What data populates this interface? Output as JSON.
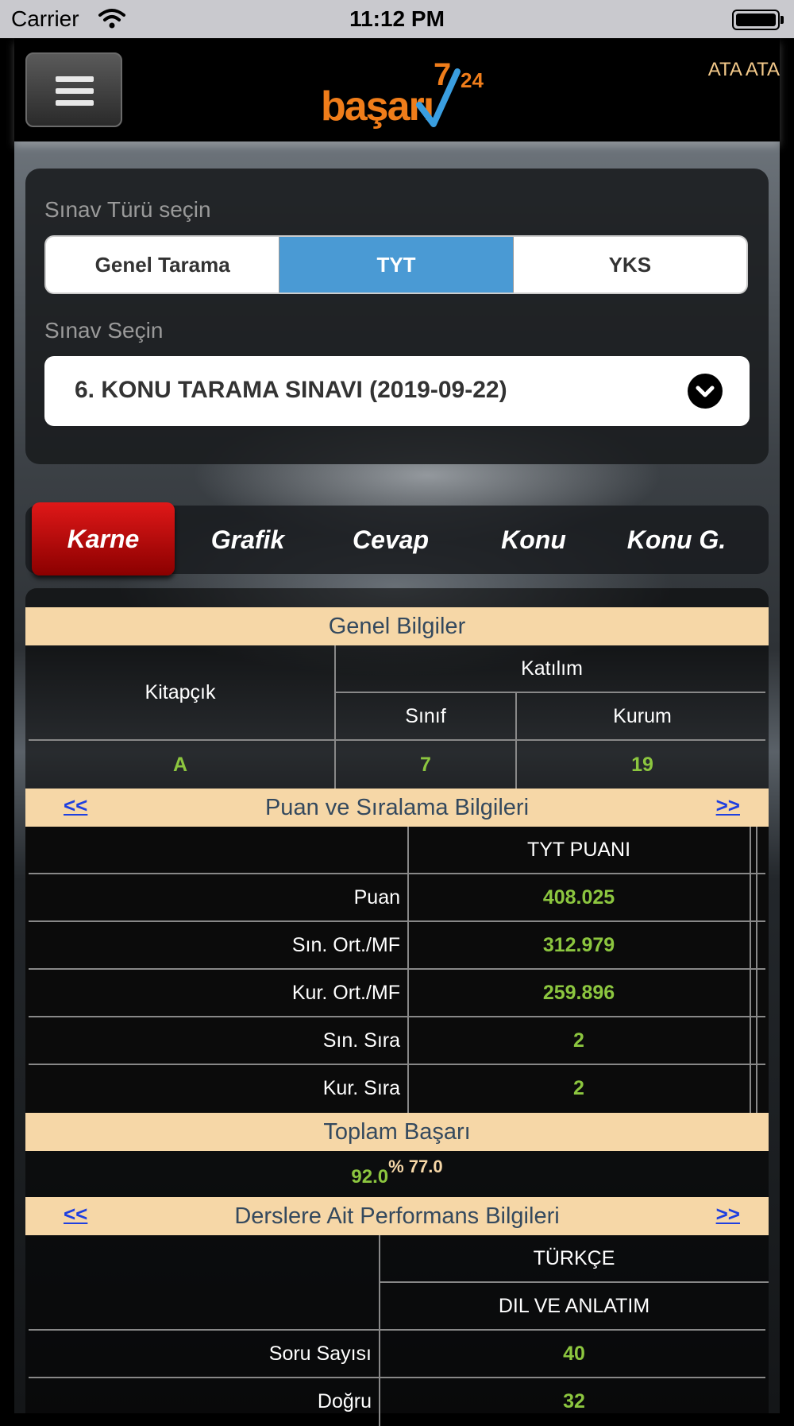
{
  "status_bar": {
    "carrier": "Carrier",
    "time": "11:12 PM"
  },
  "header": {
    "logo_word": "başarı",
    "logo_seven": "7",
    "logo_24": "24",
    "user_name": "ATA ATA"
  },
  "exam_type": {
    "label": "Sınav Türü seçin",
    "options": [
      "Genel Tarama",
      "TYT",
      "YKS"
    ],
    "selected": "TYT"
  },
  "exam_select": {
    "label": "Sınav Seçin",
    "value": "6. KONU TARAMA SINAVI (2019-09-22)"
  },
  "tabs": [
    "Karne",
    "Grafik",
    "Cevap",
    "Konu",
    "Konu G."
  ],
  "active_tab": "Karne",
  "genel_bilgiler": {
    "title": "Genel Bilgiler",
    "kitapcik_label": "Kitapçık",
    "katilim_label": "Katılım",
    "sinif_label": "Sınıf",
    "kurum_label": "Kurum",
    "kitapcik": "A",
    "sinif": "7",
    "kurum": "19"
  },
  "puan": {
    "title": "Puan ve Sıralama Bilgileri",
    "prev": "<<",
    "next": ">>",
    "column": "TYT PUANI",
    "rows": [
      {
        "label": "Puan",
        "value": "408.025"
      },
      {
        "label": "Sın. Ort./MF",
        "value": "312.979"
      },
      {
        "label": "Kur. Ort./MF",
        "value": "259.896"
      },
      {
        "label": "Sın. Sıra",
        "value": "2"
      },
      {
        "label": "Kur. Sıra",
        "value": "2"
      }
    ]
  },
  "toplam": {
    "title": "Toplam Başarı",
    "value": "92.0",
    "percent": "% 77.0"
  },
  "dersler": {
    "title": "Derslere Ait Performans Bilgileri",
    "prev": "<<",
    "next": ">>",
    "subject": "TÜRKÇE",
    "subsubject": "DIL VE ANLATIM",
    "rows": [
      {
        "label": "Soru Sayısı",
        "value": "40"
      },
      {
        "label": "Doğru",
        "value": "32"
      }
    ]
  },
  "colors": {
    "accent_blue": "#4a9ad4",
    "tab_red": "#c00000",
    "section_header": "#f6d7a7",
    "value_green": "#8cc63f",
    "logo_orange": "#f07d1a"
  }
}
